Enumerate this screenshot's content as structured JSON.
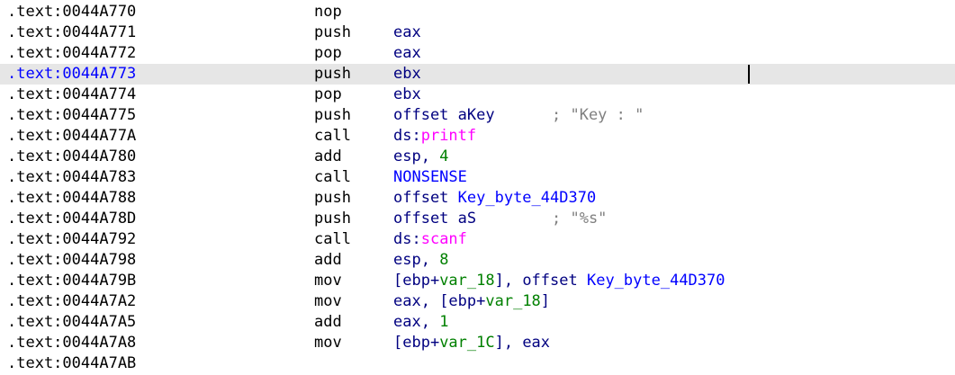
{
  "listing": {
    "rows": [
      {
        "addr": ".text:0044A770",
        "mnemonic": "nop",
        "operands": [],
        "comment": ""
      },
      {
        "addr": ".text:0044A771",
        "mnemonic": "push",
        "operands": [
          {
            "text": "eax",
            "kind": "reg"
          }
        ],
        "comment": ""
      },
      {
        "addr": ".text:0044A772",
        "mnemonic": "pop",
        "operands": [
          {
            "text": "eax",
            "kind": "reg"
          }
        ],
        "comment": ""
      },
      {
        "addr": ".text:0044A773",
        "mnemonic": "push",
        "operands": [
          {
            "text": "ebx",
            "kind": "reg"
          }
        ],
        "comment": "",
        "current": true
      },
      {
        "addr": ".text:0044A774",
        "mnemonic": "pop",
        "operands": [
          {
            "text": "ebx",
            "kind": "reg"
          }
        ],
        "comment": ""
      },
      {
        "addr": ".text:0044A775",
        "mnemonic": "push",
        "operands": [
          {
            "text": "offset ",
            "kind": "kw"
          },
          {
            "text": "aKey",
            "kind": "name"
          }
        ],
        "comment": "; \"Key : \"",
        "comment_col": 613
      },
      {
        "addr": ".text:0044A77A",
        "mnemonic": "call",
        "operands": [
          {
            "text": "ds:",
            "kind": "kw"
          },
          {
            "text": "printf",
            "kind": "imp"
          }
        ],
        "comment": ""
      },
      {
        "addr": ".text:0044A780",
        "mnemonic": "add",
        "operands": [
          {
            "text": "esp",
            "kind": "reg"
          },
          {
            "text": ", ",
            "kind": "punct"
          },
          {
            "text": "4",
            "kind": "num"
          }
        ],
        "comment": ""
      },
      {
        "addr": ".text:0044A783",
        "mnemonic": "call",
        "operands": [
          {
            "text": "NONSENSE",
            "kind": "sym"
          }
        ],
        "comment": ""
      },
      {
        "addr": ".text:0044A788",
        "mnemonic": "push",
        "operands": [
          {
            "text": "offset ",
            "kind": "kw"
          },
          {
            "text": "Key_byte_44D370",
            "kind": "sym"
          }
        ],
        "comment": ""
      },
      {
        "addr": ".text:0044A78D",
        "mnemonic": "push",
        "operands": [
          {
            "text": "offset ",
            "kind": "kw"
          },
          {
            "text": "aS",
            "kind": "name"
          }
        ],
        "comment": "; \"%s\"",
        "comment_col": 613
      },
      {
        "addr": ".text:0044A792",
        "mnemonic": "call",
        "operands": [
          {
            "text": "ds:",
            "kind": "kw"
          },
          {
            "text": "scanf",
            "kind": "imp"
          }
        ],
        "comment": ""
      },
      {
        "addr": ".text:0044A798",
        "mnemonic": "add",
        "operands": [
          {
            "text": "esp",
            "kind": "reg"
          },
          {
            "text": ", ",
            "kind": "punct"
          },
          {
            "text": "8",
            "kind": "num"
          }
        ],
        "comment": ""
      },
      {
        "addr": ".text:0044A79B",
        "mnemonic": "mov",
        "operands": [
          {
            "text": "[ebp+",
            "kind": "reg"
          },
          {
            "text": "var_18",
            "kind": "var"
          },
          {
            "text": "], offset ",
            "kind": "kw"
          },
          {
            "text": "Key_byte_44D370",
            "kind": "sym"
          }
        ],
        "comment": ""
      },
      {
        "addr": ".text:0044A7A2",
        "mnemonic": "mov",
        "operands": [
          {
            "text": "eax",
            "kind": "reg"
          },
          {
            "text": ", [ebp+",
            "kind": "punct"
          },
          {
            "text": "var_18",
            "kind": "var"
          },
          {
            "text": "]",
            "kind": "punct"
          }
        ],
        "comment": ""
      },
      {
        "addr": ".text:0044A7A5",
        "mnemonic": "add",
        "operands": [
          {
            "text": "eax",
            "kind": "reg"
          },
          {
            "text": ", ",
            "kind": "punct"
          },
          {
            "text": "1",
            "kind": "num"
          }
        ],
        "comment": ""
      },
      {
        "addr": ".text:0044A7A8",
        "mnemonic": "mov",
        "operands": [
          {
            "text": "[ebp+",
            "kind": "reg"
          },
          {
            "text": "var_1C",
            "kind": "var"
          },
          {
            "text": "], eax",
            "kind": "punct"
          }
        ],
        "comment": ""
      },
      {
        "addr": ".text:0044A7AB",
        "mnemonic": "",
        "operands": [],
        "comment": ""
      }
    ]
  },
  "colors": {
    "background": "#ffffff",
    "current_line": "#e6e6e6",
    "address_current": "#0000ff",
    "register": "#000080",
    "symbol": "#0000ff",
    "import": "#ff00ff",
    "variable_number": "#008000",
    "comment": "#808080"
  }
}
